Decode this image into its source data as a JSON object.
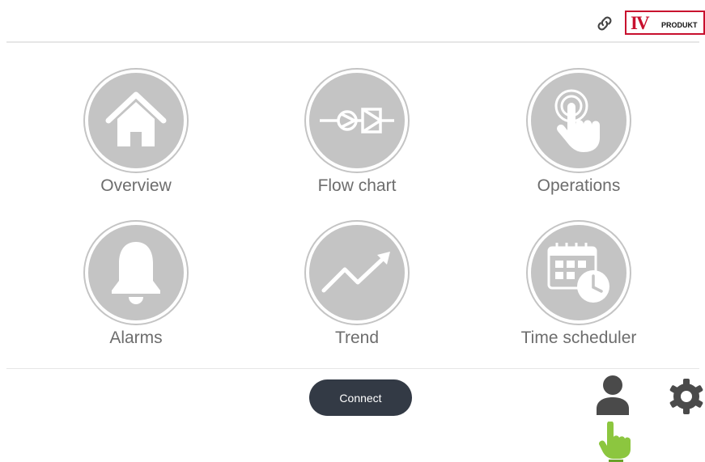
{
  "header": {
    "link_icon": "link-icon",
    "logo": {
      "mark": "IV",
      "word": "PRODUKT",
      "brand_color": "#c8102e"
    }
  },
  "tiles": [
    {
      "label": "Overview",
      "icon": "home-icon"
    },
    {
      "label": "Flow chart",
      "icon": "flow-chart-icon"
    },
    {
      "label": "Operations",
      "icon": "touch-hand-icon"
    },
    {
      "label": "Alarms",
      "icon": "bell-icon"
    },
    {
      "label": "Trend",
      "icon": "trend-icon"
    },
    {
      "label": "Time scheduler",
      "icon": "calendar-clock-icon"
    }
  ],
  "footer": {
    "connect_label": "Connect",
    "user_icon": "user-icon",
    "gear_icon": "gear-icon",
    "hand_icon": "pointing-hand-icon"
  },
  "colors": {
    "tile_gray": "#c4c4c4",
    "label_gray": "#6d6d6d",
    "button_dark": "#333a45",
    "hand_green": "#8cc63f",
    "icon_dark": "#4a4a4a"
  }
}
